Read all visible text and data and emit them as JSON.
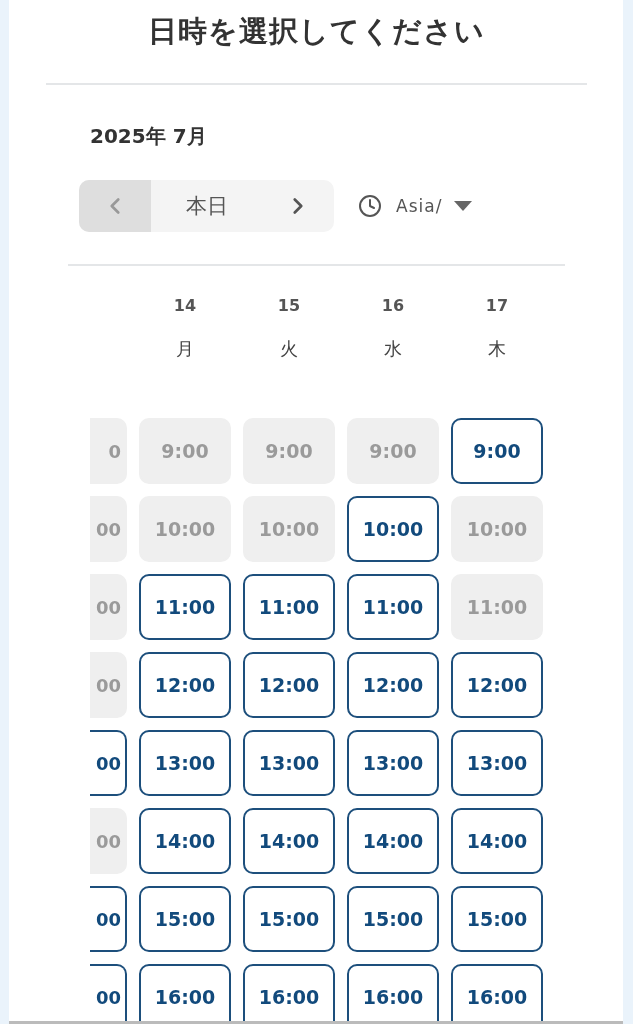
{
  "title": "日時を選択してください",
  "month": "2025年 7月",
  "nav": {
    "today": "本日"
  },
  "timezone": {
    "value": "Asia/"
  },
  "partial_column": {
    "slots": [
      {
        "time": "0",
        "available": false
      },
      {
        "time": "00",
        "available": false
      },
      {
        "time": "00",
        "available": false
      },
      {
        "time": "00",
        "available": false
      },
      {
        "time": "00",
        "available": true
      },
      {
        "time": "00",
        "available": false
      },
      {
        "time": "00",
        "available": true
      },
      {
        "time": "00",
        "available": true
      }
    ]
  },
  "days": [
    {
      "date": "14",
      "weekday": "月",
      "slots": [
        {
          "time": "9:00",
          "available": false
        },
        {
          "time": "10:00",
          "available": false
        },
        {
          "time": "11:00",
          "available": true
        },
        {
          "time": "12:00",
          "available": true
        },
        {
          "time": "13:00",
          "available": true
        },
        {
          "time": "14:00",
          "available": true
        },
        {
          "time": "15:00",
          "available": true
        },
        {
          "time": "16:00",
          "available": true
        }
      ]
    },
    {
      "date": "15",
      "weekday": "火",
      "slots": [
        {
          "time": "9:00",
          "available": false
        },
        {
          "time": "10:00",
          "available": false
        },
        {
          "time": "11:00",
          "available": true
        },
        {
          "time": "12:00",
          "available": true
        },
        {
          "time": "13:00",
          "available": true
        },
        {
          "time": "14:00",
          "available": true
        },
        {
          "time": "15:00",
          "available": true
        },
        {
          "time": "16:00",
          "available": true
        }
      ]
    },
    {
      "date": "16",
      "weekday": "水",
      "slots": [
        {
          "time": "9:00",
          "available": false
        },
        {
          "time": "10:00",
          "available": true
        },
        {
          "time": "11:00",
          "available": true
        },
        {
          "time": "12:00",
          "available": true
        },
        {
          "time": "13:00",
          "available": true
        },
        {
          "time": "14:00",
          "available": true
        },
        {
          "time": "15:00",
          "available": true
        },
        {
          "time": "16:00",
          "available": true
        }
      ]
    },
    {
      "date": "17",
      "weekday": "木",
      "slots": [
        {
          "time": "9:00",
          "available": true
        },
        {
          "time": "10:00",
          "available": false
        },
        {
          "time": "11:00",
          "available": false
        },
        {
          "time": "12:00",
          "available": true
        },
        {
          "time": "13:00",
          "available": true
        },
        {
          "time": "14:00",
          "available": true
        },
        {
          "time": "15:00",
          "available": true
        },
        {
          "time": "16:00",
          "available": true
        }
      ]
    }
  ]
}
